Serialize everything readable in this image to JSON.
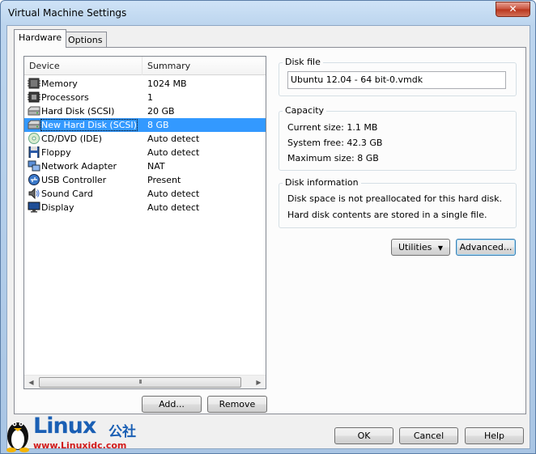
{
  "window": {
    "title": "Virtual Machine Settings",
    "close_glyph": "✕"
  },
  "tabs": [
    {
      "label": "Hardware",
      "active": true
    },
    {
      "label": "Options",
      "active": false
    }
  ],
  "device_list": {
    "columns": [
      "Device",
      "Summary"
    ],
    "rows": [
      {
        "icon": "memory-icon",
        "device": "Memory",
        "summary": "1024 MB",
        "selected": false
      },
      {
        "icon": "processor-icon",
        "device": "Processors",
        "summary": "1",
        "selected": false
      },
      {
        "icon": "hard-disk-icon",
        "device": "Hard Disk (SCSI)",
        "summary": "20 GB",
        "selected": false
      },
      {
        "icon": "hard-disk-icon",
        "device": "New Hard Disk (SCSI)",
        "summary": "8 GB",
        "selected": true
      },
      {
        "icon": "cd-dvd-icon",
        "device": "CD/DVD (IDE)",
        "summary": "Auto detect",
        "selected": false
      },
      {
        "icon": "floppy-icon",
        "device": "Floppy",
        "summary": "Auto detect",
        "selected": false
      },
      {
        "icon": "network-adapter-icon",
        "device": "Network Adapter",
        "summary": "NAT",
        "selected": false
      },
      {
        "icon": "usb-icon",
        "device": "USB Controller",
        "summary": "Present",
        "selected": false
      },
      {
        "icon": "sound-card-icon",
        "device": "Sound Card",
        "summary": "Auto detect",
        "selected": false
      },
      {
        "icon": "display-icon",
        "device": "Display",
        "summary": "Auto detect",
        "selected": false
      }
    ],
    "scroll_thumb_glyph": "III",
    "scroll_left_glyph": "◀",
    "scroll_right_glyph": "▶"
  },
  "list_buttons": {
    "add": "Add...",
    "remove": "Remove"
  },
  "disk_file": {
    "title": "Disk file",
    "value": "Ubuntu 12.04 - 64 bit-0.vmdk"
  },
  "capacity": {
    "title": "Capacity",
    "current_size": "Current size:  1.1 MB",
    "system_free": "System free:  42.3 GB",
    "maximum_size": "Maximum size:  8 GB"
  },
  "disk_information": {
    "title": "Disk information",
    "line1": "Disk space is not preallocated for this hard disk.",
    "line2": "Hard disk contents are stored in a single file."
  },
  "disk_buttons": {
    "utilities": "Utilities",
    "utilities_arrow": "▼",
    "advanced": "Advanced..."
  },
  "dialog_buttons": {
    "ok": "OK",
    "cancel": "Cancel",
    "help": "Help"
  },
  "watermark": {
    "brand": "Linux",
    "brand_cn": "公社",
    "url": "www.Linuxidc.com"
  }
}
